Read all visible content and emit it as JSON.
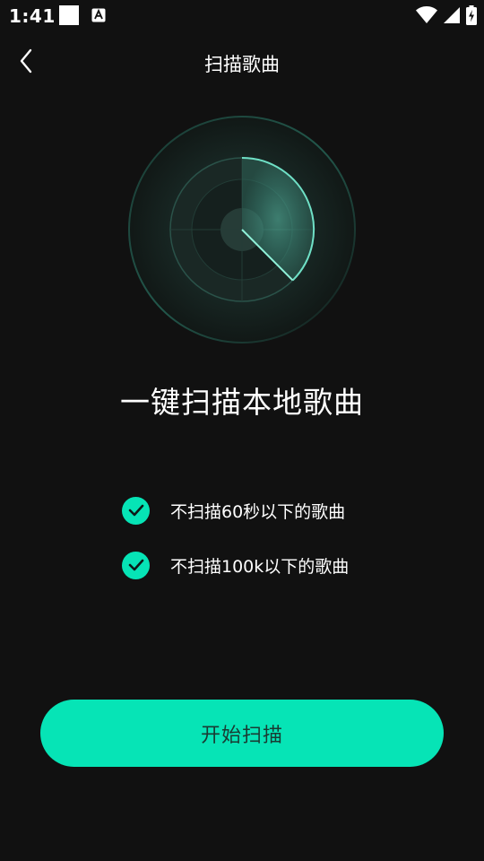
{
  "status_bar": {
    "time": "1:41",
    "icons": [
      "white-square-icon",
      "a-notification-icon",
      "wifi-icon",
      "signal-icon",
      "battery-charging-icon"
    ]
  },
  "app_bar": {
    "back_icon": "chevron-left-icon",
    "title": "扫描歌曲"
  },
  "radar": {
    "icon": "radar-scan-icon"
  },
  "headline": "一键扫描本地歌曲",
  "rules": [
    {
      "text": "不扫描60秒以下的歌曲",
      "icon": "check-circle-icon"
    },
    {
      "text": "不扫描100k以下的歌曲",
      "icon": "check-circle-icon"
    }
  ],
  "start_button": {
    "label": "开始扫描"
  },
  "colors": {
    "background": "#111111",
    "accent": "#06e4b6",
    "button_text": "#1a3a32",
    "text": "#ffffff"
  }
}
